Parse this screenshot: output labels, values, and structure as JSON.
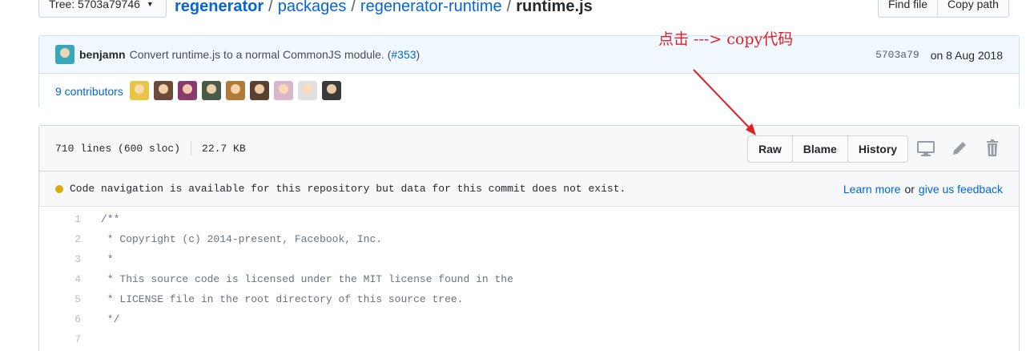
{
  "topbar": {
    "tree_label": "Tree: 5703a79746",
    "breadcrumbs": [
      "regenerator",
      "packages",
      "regenerator-runtime"
    ],
    "separator": "/",
    "file_name": "runtime.js",
    "find_file": "Find file",
    "copy_path": "Copy path"
  },
  "commit": {
    "author": "benjamn",
    "message": "Convert runtime.js to a normal CommonJS module. (",
    "pr": "#353",
    "message_end": ")",
    "sha": "5703a79",
    "date": "on 8 Aug 2018",
    "contributors": "9 contributors",
    "avatar_colors": [
      "#e8c547",
      "#6b4a3a",
      "#8a3b6e",
      "#4a5a4a",
      "#b07a3a",
      "#5a4030",
      "#d9b6c9",
      "#e0e0e0",
      "#3a3a3a"
    ]
  },
  "file": {
    "lines": "710 lines (600 sloc)",
    "size": "22.7 KB",
    "raw": "Raw",
    "blame": "Blame",
    "history": "History"
  },
  "navigation": {
    "notice": "Code navigation is available for this repository but data for this commit does not exist.",
    "learn_more": "Learn more",
    "or": "or",
    "feedback": "give us feedback"
  },
  "code": [
    {
      "n": "1",
      "t": "/**"
    },
    {
      "n": "2",
      "t": " * Copyright (c) 2014-present, Facebook, Inc."
    },
    {
      "n": "3",
      "t": " *"
    },
    {
      "n": "4",
      "t": " * This source code is licensed under the MIT license found in the"
    },
    {
      "n": "5",
      "t": " * LICENSE file in the root directory of this source tree."
    },
    {
      "n": "6",
      "t": " */"
    },
    {
      "n": "7",
      "t": ""
    }
  ],
  "annotation": "点击 ---> copy代码",
  "colors": {
    "link": "#0366d6",
    "annotation": "#e02020",
    "notice_dot": "#dbab09"
  }
}
